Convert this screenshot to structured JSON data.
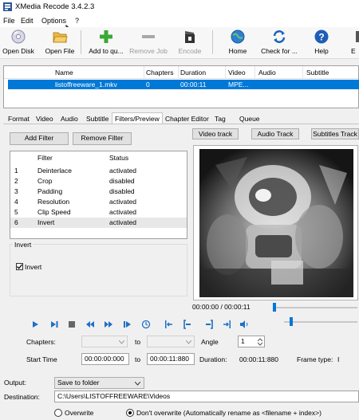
{
  "window": {
    "title": "XMedia Recode 3.4.2.3"
  },
  "menu": {
    "items": [
      "File",
      "Edit",
      "Options",
      "?"
    ]
  },
  "toolbar": {
    "open_disk": "Open Disk",
    "open_file": "Open File",
    "add_to_queue": "Add to qu...",
    "remove_job": "Remove Job",
    "encode": "Encode",
    "home": "Home",
    "check_for_updates": "Check for ...",
    "help": "Help",
    "exit_partial": "E"
  },
  "file_list": {
    "columns": [
      "Name",
      "Chapters",
      "Duration",
      "Video",
      "Audio",
      "Subtitle"
    ],
    "rows": [
      {
        "name": "listoffreeware_1.mkv",
        "chapters": "0",
        "duration": "00:00:11",
        "video": "MPE...",
        "audio": "",
        "subtitle": ""
      }
    ]
  },
  "tabs": [
    "Format",
    "Video",
    "Audio",
    "Subtitle",
    "Filters/Preview",
    "Chapter Editor",
    "Tag",
    "Queue"
  ],
  "active_tab": "Filters/Preview",
  "filters": {
    "add_label": "Add Filter",
    "remove_label": "Remove Filter",
    "col_filter": "Filter",
    "col_status": "Status",
    "rows": [
      {
        "num": "1",
        "filter": "Deinterlace",
        "status": "activated"
      },
      {
        "num": "2",
        "filter": "Crop",
        "status": "disabled"
      },
      {
        "num": "3",
        "filter": "Padding",
        "status": "disabled"
      },
      {
        "num": "4",
        "filter": "Resolution",
        "status": "activated"
      },
      {
        "num": "5",
        "filter": "Clip Speed",
        "status": "activated"
      },
      {
        "num": "6",
        "filter": "Invert",
        "status": "activated"
      }
    ]
  },
  "invert_group": {
    "title": "Invert",
    "checkbox_label": "Invert",
    "checked": true
  },
  "preview": {
    "video_track": "Video track",
    "audio_track": "Audio Track",
    "subtitles_track": "Subtitles Track",
    "timecode": "00:00:00 / 00:00:11"
  },
  "trim": {
    "chapters_label": "Chapters:",
    "to_label_1": "to",
    "angle_label": "Angle",
    "angle_value": "1",
    "start_label": "Start Time",
    "start_value": "00:00:00:000",
    "to_label_2": "to",
    "end_value": "00:00:11:880",
    "duration_label": "Duration:",
    "duration_value": "00:00:11:880",
    "frame_type_label": "Frame type:",
    "frame_type_value": "I"
  },
  "output": {
    "output_label": "Output:",
    "output_value": "Save to folder",
    "destination_label": "Destination:",
    "destination_value": "C:\\Users\\LISTOFFREEWARE\\Videos",
    "overwrite_label": "Overwrite",
    "dont_overwrite_label": "Don't overwrite (Automatically rename as <filename + index>)"
  },
  "colors": {
    "selection": "#0078d7",
    "accent_green": "#3aa935",
    "accent_blue": "#1565c0"
  }
}
